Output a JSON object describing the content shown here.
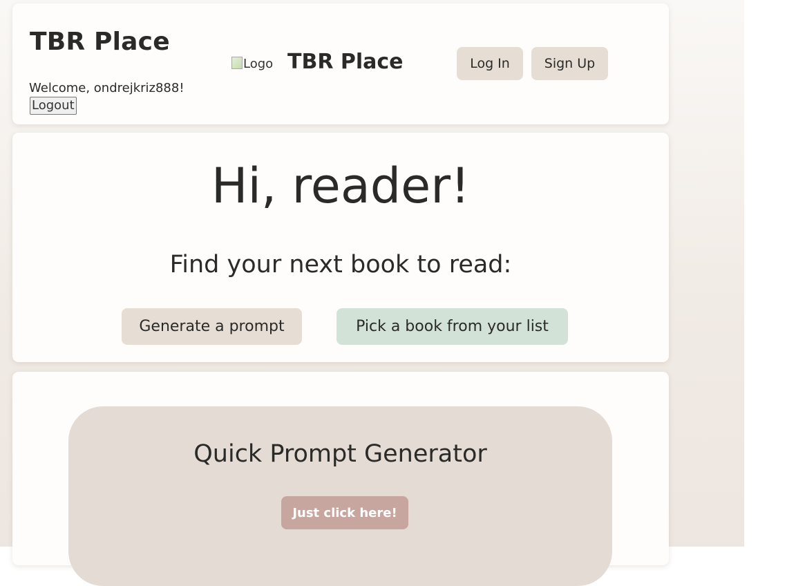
{
  "header": {
    "site_title": "TBR Place",
    "welcome_text": "Welcome, ondrejkriz888!",
    "logout_label": "Logout",
    "logo_alt": "Logo",
    "nav_title": "TBR Place",
    "login_label": "Log In",
    "signup_label": "Sign Up"
  },
  "hero": {
    "heading": "Hi, reader!",
    "subheading": "Find your next book to read:",
    "generate_label": "Generate a prompt",
    "pick_label": "Pick a book from your list"
  },
  "quick_prompt": {
    "title": "Quick Prompt Generator",
    "button_label": "Just click here!"
  },
  "colors": {
    "neutral_button": "#e6ddd5",
    "green_button": "#d3e2d6",
    "accent_button": "#c7a69f",
    "panel": "#e4dbd4",
    "text": "#2a2a28"
  }
}
